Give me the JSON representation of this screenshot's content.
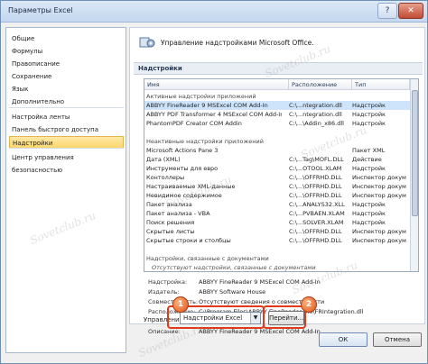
{
  "window": {
    "title": "Параметры Excel",
    "help_glyph": "?",
    "close_glyph": "✕"
  },
  "nav": {
    "items": [
      {
        "label": "Общие"
      },
      {
        "label": "Формулы"
      },
      {
        "label": "Правописание"
      },
      {
        "label": "Сохранение"
      },
      {
        "label": "Язык"
      },
      {
        "label": "Дополнительно"
      },
      {
        "label": "Настройка ленты"
      },
      {
        "label": "Панель быстрого доступа"
      },
      {
        "label": "Надстройки"
      },
      {
        "label": "Центр управления безопасностью"
      }
    ],
    "selected_index": 8
  },
  "content": {
    "header": "Управление надстройками Microsoft Office.",
    "section_title": "Надстройки",
    "columns": {
      "name": "Имя",
      "location": "Расположение",
      "type": "Тип"
    },
    "rows": [
      {
        "kind": "group",
        "name": "Активные надстройки приложений"
      },
      {
        "kind": "item",
        "name": "ABBYY FineReader 9 MSExcel COM Add-In",
        "location": "C:\\...ntegration.dll",
        "type": "Надстройк",
        "selected": true
      },
      {
        "kind": "item",
        "name": "ABBYY PDF Transformer 4 MSExcel COM Add-In",
        "location": "C:\\...ntegration.dll",
        "type": "Надстройк"
      },
      {
        "kind": "item",
        "name": "PhantomPDF Creator COM Addin",
        "location": "C:\\...\\Addin_x86.dll",
        "type": "Надстройк"
      },
      {
        "kind": "blank"
      },
      {
        "kind": "group",
        "name": "Неактивные надстройки приложений"
      },
      {
        "kind": "item",
        "name": "Microsoft Actions Pane 3",
        "location": "",
        "type": "Пакет XML"
      },
      {
        "kind": "item",
        "name": "Дата (XML)",
        "location": "C:\\...Tag\\MOFL.DLL",
        "type": "Действие"
      },
      {
        "kind": "item",
        "name": "Инструменты для евро",
        "location": "C:\\...OTOOL.XLAM",
        "type": "Надстройк"
      },
      {
        "kind": "item",
        "name": "Контоллеры",
        "location": "C:\\...\\OFFRHD.DLL",
        "type": "Инспектор докум"
      },
      {
        "kind": "item",
        "name": "Настраиваемые XML-данные",
        "location": "C:\\...\\OFFRHD.DLL",
        "type": "Инспектор докум"
      },
      {
        "kind": "item",
        "name": "Невидимое содержимое",
        "location": "C:\\...\\OFFRHD.DLL",
        "type": "Инспектор докум"
      },
      {
        "kind": "item",
        "name": "Пакет анализа",
        "location": "C:\\...ANALYS32.XLL",
        "type": "Надстройк"
      },
      {
        "kind": "item",
        "name": "Пакет анализа - VBA",
        "location": "C:\\...PVBAEN.XLAM",
        "type": "Надстройк"
      },
      {
        "kind": "item",
        "name": "Поиск решения",
        "location": "C:\\...SOLVER.XLAM",
        "type": "Надстройк"
      },
      {
        "kind": "item",
        "name": "Скрытые листы",
        "location": "C:\\...\\OFFRHD.DLL",
        "type": "Инспектор докум"
      },
      {
        "kind": "item",
        "name": "Скрытые строки и столбцы",
        "location": "C:\\...\\OFFRHD.DLL",
        "type": "Инспектор докум"
      },
      {
        "kind": "blank"
      },
      {
        "kind": "group",
        "name": "Надстройки, связанные с документами"
      },
      {
        "kind": "note",
        "name": "Отсутствуют надстройки, связанные с документами"
      }
    ],
    "details": [
      {
        "label": "Надстройка:",
        "value": "ABBYY FineReader 9 MSExcel COM Add-In"
      },
      {
        "label": "Издатель:",
        "value": "ABBYY Software House"
      },
      {
        "label": "Совместимость:",
        "value": "Отсутствуют сведения о совместимости"
      },
      {
        "label": "Расположение:",
        "value": "C:\\Program Files\\ABBYY FineReader 9.0\\FRIntegration.dll"
      },
      {
        "label": "",
        "value": ""
      },
      {
        "label": "Описание:",
        "value": "ABBYY FineReader 9 MSExcel COM Add-In"
      }
    ]
  },
  "manage": {
    "label": "Управление:",
    "selected": "Надстройки Excel",
    "go_label": "Перейти...",
    "badge1": "1",
    "badge2": "2",
    "arrow_glyph": "▼"
  },
  "footer": {
    "ok_label": "ОК",
    "cancel_label": "Отмена"
  },
  "watermark": "Sovetclub.ru"
}
